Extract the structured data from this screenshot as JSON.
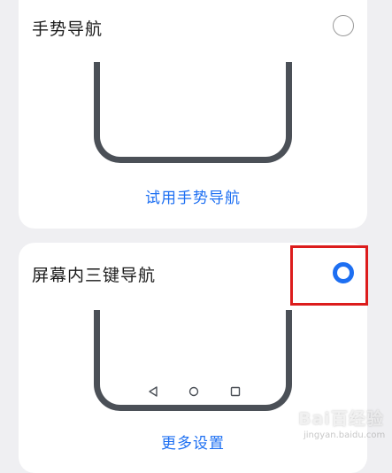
{
  "gesture_card": {
    "title": "手势导航",
    "selected": false,
    "action_label": "试用手势导航"
  },
  "three_key_card": {
    "title": "屏幕内三键导航",
    "selected": true,
    "action_label": "更多设置",
    "nav_keys": [
      "back-triangle-icon",
      "home-circle-icon",
      "recent-square-icon"
    ]
  },
  "watermark": {
    "brand": "Bai百经验",
    "sub": "jingyan.baidu.com"
  },
  "colors": {
    "accent": "#1d6ff2",
    "highlight": "#dc1c1c",
    "phone_frame": "#4b5057",
    "background": "#efeff2"
  }
}
